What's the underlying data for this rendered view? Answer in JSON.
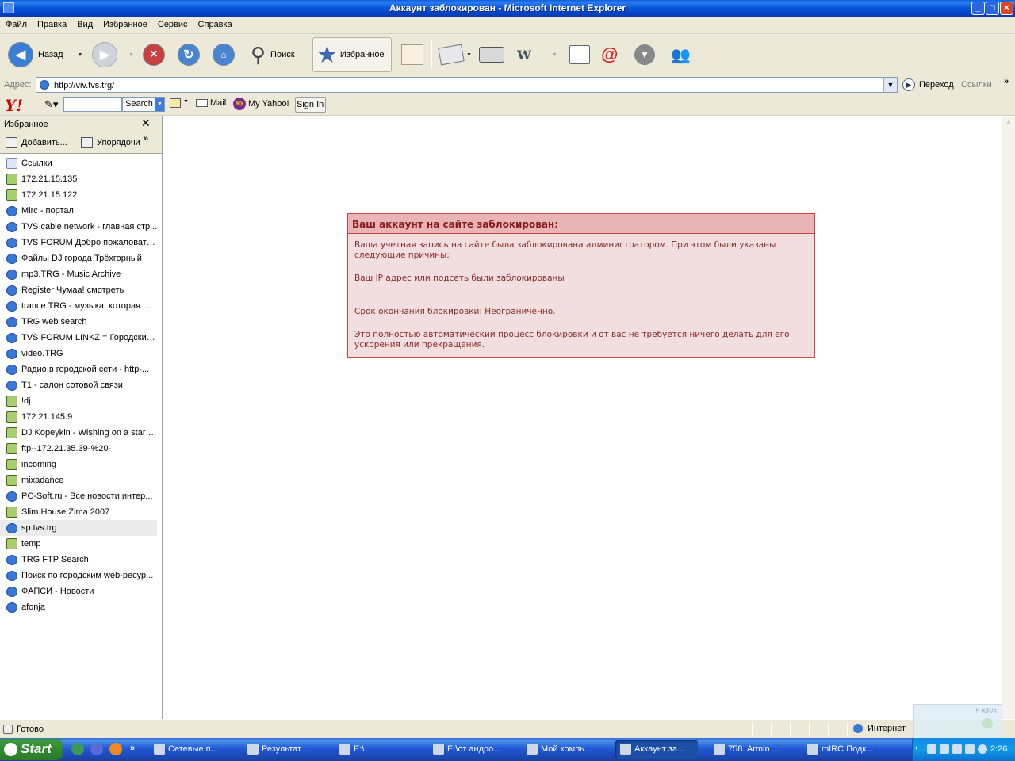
{
  "window": {
    "title": "Аккаунт заблокирован - Microsoft Internet Explorer"
  },
  "menu": [
    "Файл",
    "Правка",
    "Вид",
    "Избранное",
    "Сервис",
    "Справка"
  ],
  "toolbar": {
    "back": "Назад",
    "search": "Поиск",
    "favorites": "Избранное"
  },
  "address": {
    "label": "Адрес:",
    "url": "http://viv.tvs.trg/",
    "go": "Переход",
    "links": "Ссылки",
    "more": "»"
  },
  "yahoo": {
    "search_button": "Search",
    "mail": "Mail",
    "myyahoo": "My Yahoo!",
    "signin": "Sign In",
    "myicon": "My"
  },
  "favorites": {
    "title": "Избранное",
    "add": "Добавить...",
    "organize": "Упорядочи",
    "more": "»",
    "items": [
      {
        "label": "Ссылки",
        "icon": "folder"
      },
      {
        "label": "172.21.15.135",
        "icon": "ftp"
      },
      {
        "label": "172.21.15.122",
        "icon": "ftp"
      },
      {
        "label": "Mirc - портал",
        "icon": "ie"
      },
      {
        "label": "TVS cable network - главная стр...",
        "icon": "ie"
      },
      {
        "label": "TVS FORUM Добро пожаловать...",
        "icon": "ie"
      },
      {
        "label": "Файлы DJ города Трёхгорный",
        "icon": "ie"
      },
      {
        "label": "mp3.TRG - Music Archive",
        "icon": "ie"
      },
      {
        "label": "Register Чумаа! смотреть",
        "icon": "ie"
      },
      {
        "label": "trance.TRG - музыка, которая ...",
        "icon": "ie"
      },
      {
        "label": "TRG web search",
        "icon": "ie"
      },
      {
        "label": "TVS FORUM LINKZ = Городские ...",
        "icon": "ie"
      },
      {
        "label": "video.TRG",
        "icon": "ie"
      },
      {
        "label": "Радио в городской сети - http-...",
        "icon": "ie"
      },
      {
        "label": "T1 - салон сотовой связи",
        "icon": "ie"
      },
      {
        "label": "!dj",
        "icon": "ftp"
      },
      {
        "label": "172.21.145.9",
        "icon": "ftp"
      },
      {
        "label": "DJ Kopeykin - Wishing on a star (...",
        "icon": "ftp"
      },
      {
        "label": "ftp--172.21.35.39-%20-",
        "icon": "ftp"
      },
      {
        "label": "incoming",
        "icon": "ftp"
      },
      {
        "label": "mixadance",
        "icon": "ftp"
      },
      {
        "label": "PC-Soft.ru - Все новости интер...",
        "icon": "ie"
      },
      {
        "label": "Slim House Zima 2007",
        "icon": "ftp"
      },
      {
        "label": "sp.tvs.trg",
        "icon": "ie"
      },
      {
        "label": "temp",
        "icon": "ftp"
      },
      {
        "label": "TRG FTP Search",
        "icon": "ie"
      },
      {
        "label": "Поиск по городским web-ресур...",
        "icon": "ie"
      },
      {
        "label": "ФАПСИ - Новости",
        "icon": "ie"
      },
      {
        "label": "afonja",
        "icon": "ie"
      }
    ]
  },
  "message": {
    "heading": "Ваш аккаунт на сайте заблокирован:",
    "p1": "Ваша учетная запись на сайте была заблокирована администратором. При этом были указаны следующие причины:",
    "p2": "Ваш IP адрес или подсеть были заблокированы",
    "p3": "Срок окончания блокировки: Неограниченно.",
    "p4": "Это полностью автоматический процесс блокировки и от вас не требуется ничего делать для его ускорения или прекращения."
  },
  "status": {
    "text": "Готово",
    "zone": "Интернет",
    "speed": "5 KB/s"
  },
  "taskbar": {
    "start": "Start",
    "more": "»",
    "tasks": [
      "Сетевые п...",
      "Результат...",
      "E:\\",
      "E:\\от андро...",
      "Мой компь...",
      "Аккаунт за...",
      "758. Armin ...",
      "mIRC Подк..."
    ],
    "clock": "2:26"
  }
}
